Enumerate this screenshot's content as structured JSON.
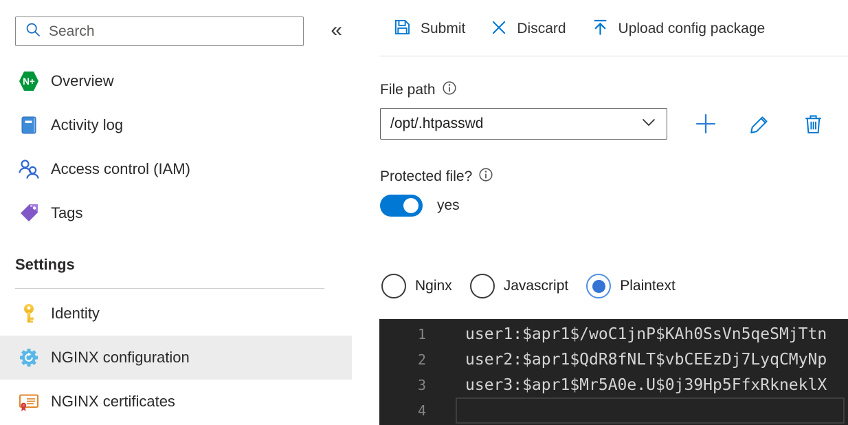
{
  "sidebar": {
    "search": {
      "placeholder": "Search"
    },
    "collapse_icon": "«",
    "items": [
      {
        "label": "Overview",
        "icon": "nginx-plus-logo",
        "badge": "N+"
      },
      {
        "label": "Activity log",
        "icon": "activity-log"
      },
      {
        "label": "Access control (IAM)",
        "icon": "access-control"
      },
      {
        "label": "Tags",
        "icon": "tag"
      }
    ],
    "settings_heading": "Settings",
    "settings_items": [
      {
        "label": "Identity",
        "icon": "key"
      },
      {
        "label": "NGINX configuration",
        "icon": "gear",
        "active": true
      },
      {
        "label": "NGINX certificates",
        "icon": "certificate"
      }
    ]
  },
  "toolbar": {
    "submit_label": "Submit",
    "discard_label": "Discard",
    "upload_label": "Upload config package"
  },
  "file_path": {
    "label": "File path",
    "value": "/opt/.htpasswd"
  },
  "protected_file": {
    "label": "Protected file?",
    "state_label": "yes",
    "enabled": true
  },
  "syntax_options": [
    {
      "label": "Nginx",
      "selected": false
    },
    {
      "label": "Javascript",
      "selected": false
    },
    {
      "label": "Plaintext",
      "selected": true
    }
  ],
  "editor": {
    "lines": [
      {
        "number": "1",
        "text": "user1:$apr1$/woC1jnP$KAh0SsVn5qeSMjTtn"
      },
      {
        "number": "2",
        "text": "user2:$apr1$QdR8fNLT$vbCEEzDj7LyqCMyNp"
      },
      {
        "number": "3",
        "text": "user3:$apr1$Mr5A0e.U$0j39Hp5FfxRkneklX"
      },
      {
        "number": "4",
        "text": "",
        "current": true
      }
    ]
  },
  "colors": {
    "accent": "#0078d4",
    "editor_background": "#242424",
    "active_item_background": "#ececec",
    "nginx_green": "#009639",
    "gear_blue": "#59b7e8"
  }
}
